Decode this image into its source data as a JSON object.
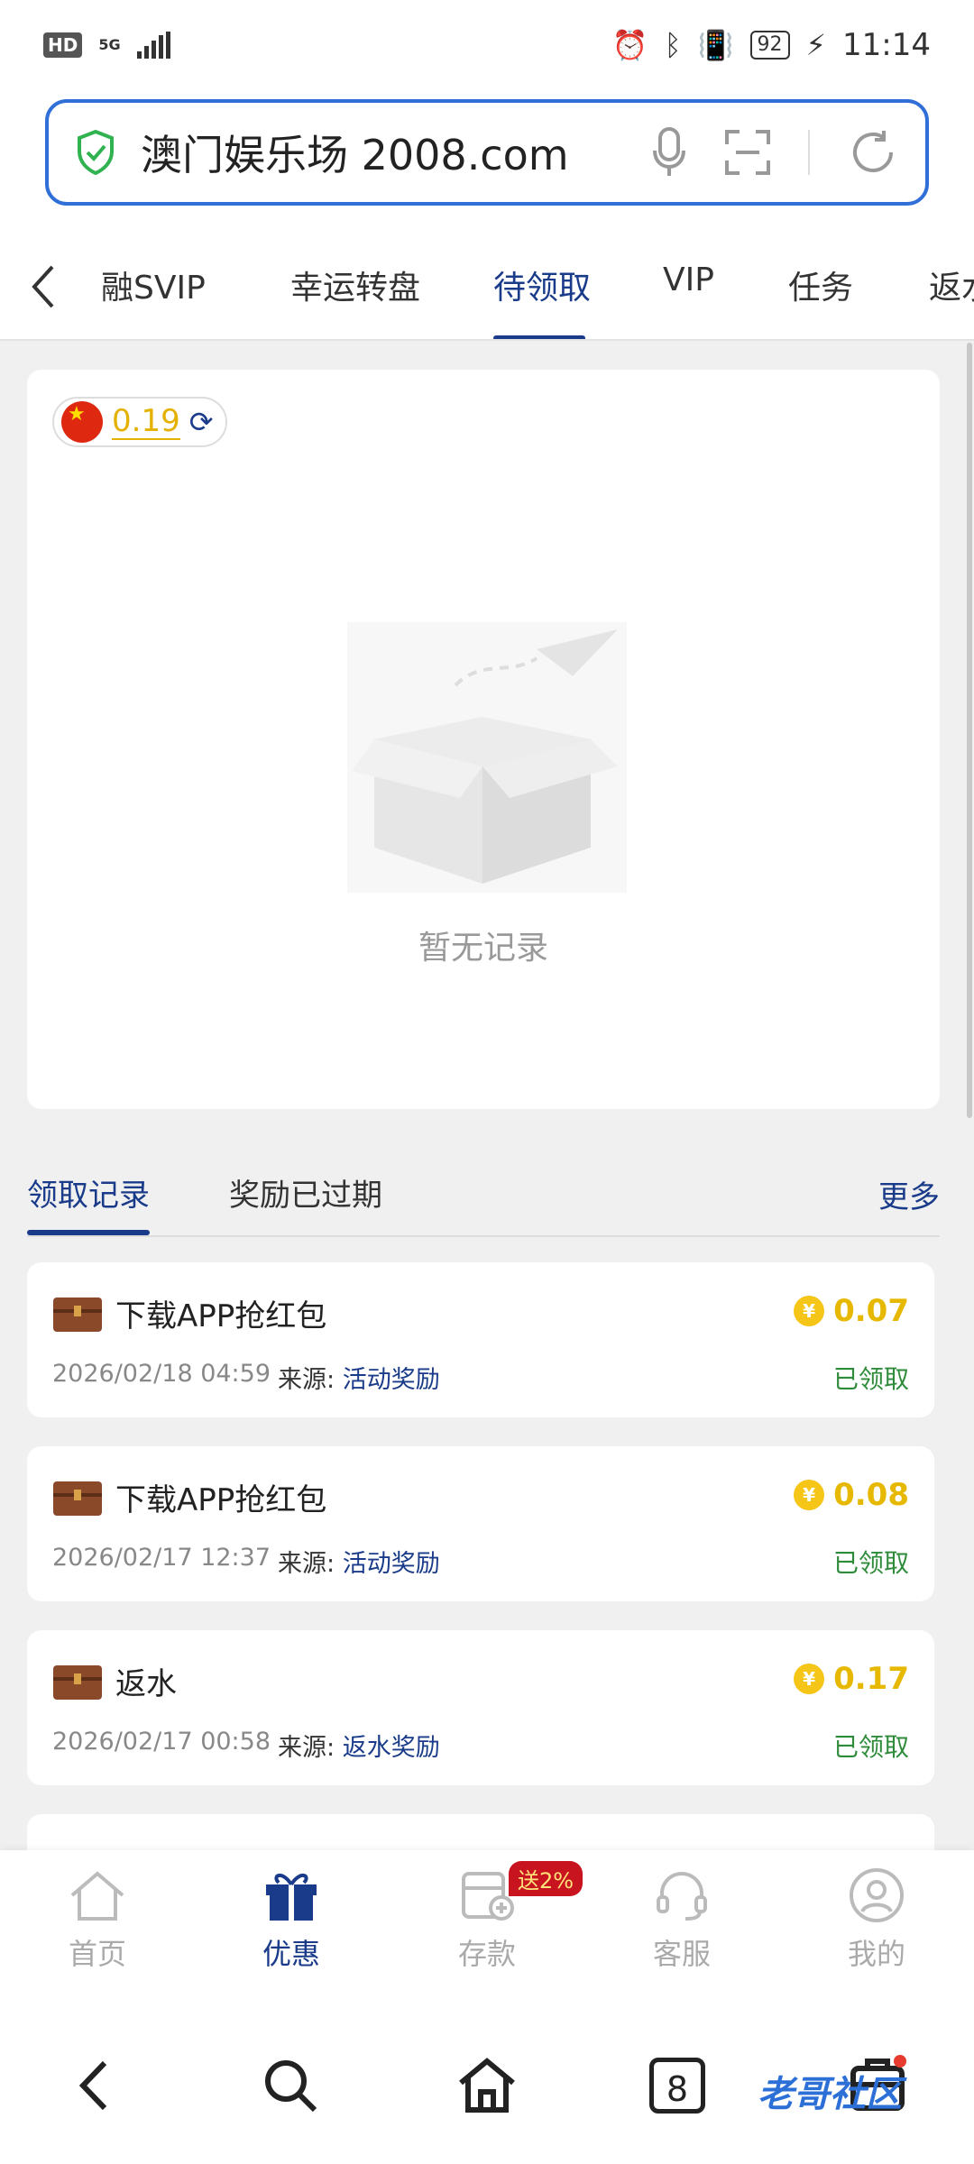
{
  "status_bar": {
    "hd": "HD",
    "network": "5G",
    "battery": "92",
    "time": "11:14"
  },
  "address_bar": {
    "url": "澳门娱乐场 2008.com"
  },
  "top_tabs": [
    "融SVIP",
    "幸运转盘",
    "待领取",
    "VIP",
    "任务",
    "返水"
  ],
  "active_tab_index": 2,
  "balance": {
    "value": "0.19"
  },
  "empty_state": {
    "text": "暂无记录"
  },
  "section_tabs": {
    "received": "领取记录",
    "expired": "奖励已过期",
    "more": "更多"
  },
  "records": [
    {
      "title": "下载APP抢红包",
      "amount": "0.07",
      "time": "2026/02/18 04:59",
      "source_label": "来源:",
      "source": "活动奖励",
      "status": "已领取"
    },
    {
      "title": "下载APP抢红包",
      "amount": "0.08",
      "time": "2026/02/17 12:37",
      "source_label": "来源:",
      "source": "活动奖励",
      "status": "已领取"
    },
    {
      "title": "返水",
      "amount": "0.17",
      "time": "2026/02/17 00:58",
      "source_label": "来源:",
      "source": "返水奖励",
      "status": "已领取"
    }
  ],
  "bottom_nav": {
    "items": [
      "首页",
      "优惠",
      "存款",
      "客服",
      "我的"
    ],
    "active_index": 1,
    "promo_badge": "送2%"
  },
  "system_nav": {
    "tab_count": "8",
    "watermark": "老哥社区"
  },
  "colors": {
    "primary": "#1a3b8a",
    "url_border": "#2f6fd7",
    "gold": "#e6b800",
    "success": "#2e8b3a"
  }
}
